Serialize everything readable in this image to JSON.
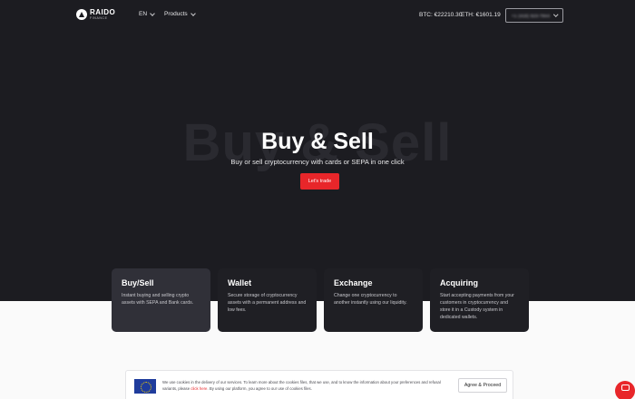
{
  "header": {
    "logo": {
      "name": "RAIDO",
      "sub": "FINANCE"
    },
    "nav": [
      {
        "label": "EN"
      },
      {
        "label": "Products"
      }
    ],
    "prices": {
      "btc": "BTC: €22210.30",
      "eth": "ETH: €1601.19"
    },
    "account_label": "+1 (415) 523-7844"
  },
  "hero": {
    "background_word": "Buy & Sell",
    "title": "Buy & Sell",
    "subtitle": "Buy or sell cryptocurrency with cards or SEPA in one click",
    "cta_label": "Let's trade"
  },
  "cards": [
    {
      "title": "Buy/Sell",
      "desc": "Instant buying and selling crypto assets with SEPA and Bank cards."
    },
    {
      "title": "Wallet",
      "desc": "Secure storage of cryptocurrency assets with a permanent address and low fees."
    },
    {
      "title": "Exchange",
      "desc": "Change one cryptocurrency to another instantly using our liquidity."
    },
    {
      "title": "Acquiring",
      "desc": "Start accepting payments from your customers in cryptocurrency and store it in a Custody system in dedicated wallets."
    }
  ],
  "cookie": {
    "text_before": "We use cookies in the delivery of our services. To learn more about the cookies files, that we use, and to know the information about your preferences and refusal variants, please ",
    "link": "click here",
    "text_after": ". By using our platform, you agree to our use of cookies files.",
    "agree_label": "Agree & Proceed"
  },
  "colors": {
    "hero_bg": "#1c1c21",
    "accent": "#e8262a",
    "card_highlight": "#303038",
    "card_bg": "#1f1f24"
  },
  "icons": [
    "raido-logo-icon",
    "chevron-down-icon",
    "eu-flag-icon",
    "chat-icon"
  ]
}
